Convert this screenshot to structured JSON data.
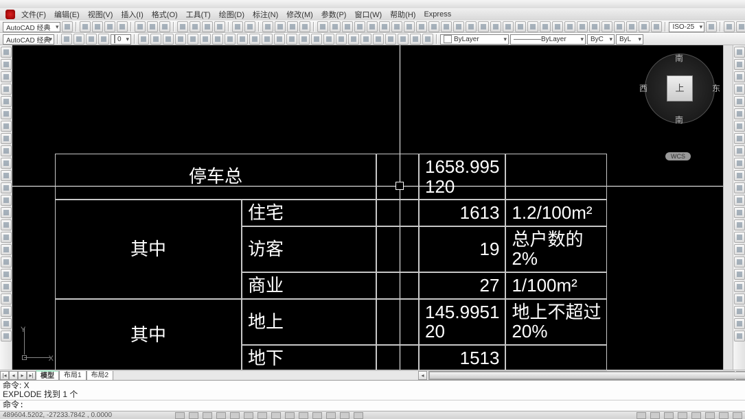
{
  "window": {
    "minimize": "—",
    "close": "✕"
  },
  "menu": [
    "文件(F)",
    "编辑(E)",
    "视图(V)",
    "插入(I)",
    "格式(O)",
    "工具(T)",
    "绘图(D)",
    "标注(N)",
    "修改(M)",
    "参数(P)",
    "窗口(W)",
    "帮助(H)",
    "Express"
  ],
  "workspace": "AutoCAD 经典",
  "dimstyle": "ISO-25",
  "layer_combo": "0",
  "linetype_combo": "ByLayer",
  "lineweight_combo": "ByLayer",
  "plotstyle_combo1": "ByC",
  "plotstyle_combo2": "ByL",
  "viewcube": {
    "top": "上",
    "n": "南",
    "s": "南",
    "e": "东",
    "w": "西",
    "wcs": "WCS"
  },
  "ucs": {
    "x": "X",
    "y": "Y"
  },
  "tabs": {
    "model": "模型",
    "layout1": "布局1",
    "layout2": "布局2"
  },
  "nav": {
    "first": "|◂",
    "prev": "◂",
    "next": "▸",
    "last": "▸|"
  },
  "scroll": {
    "left": "◂",
    "right": "▸"
  },
  "command": {
    "line1": "命令: X",
    "line2": "EXPLODE 找到 1 个",
    "prompt": "命令:"
  },
  "status": {
    "coords": "489604.5202, -27233.7842 , 0.0000"
  },
  "chart_data": {
    "type": "table",
    "title": "停车总",
    "rows": [
      {
        "label": "停车总",
        "value": "1658.995120",
        "note": ""
      },
      {
        "group": "其中",
        "label": "住宅",
        "value": "1613",
        "note": "1.2/100m²"
      },
      {
        "group": "其中",
        "label": "访客",
        "value": "19",
        "note": "总户数的2%"
      },
      {
        "group": "其中",
        "label": "商业",
        "value": "27",
        "note": "1/100m²"
      },
      {
        "group": "其中",
        "label": "地上",
        "value": "145.995120",
        "note": "地上不超过20%"
      },
      {
        "group": "其中",
        "label": "地下",
        "value": "1513",
        "note": ""
      }
    ]
  },
  "tbl": {
    "r0c0": "停车总",
    "r0c2": "1658.995",
    "r0c2b": "120",
    "g1": "其中",
    "r1c1": "住宅",
    "r1c2": "1613",
    "r1c3": "1.2/100m²",
    "r2c1": "访客",
    "r2c2": "19",
    "r2c3": "总户数的2%",
    "r3c1": "商业",
    "r3c2": "27",
    "r3c3": "1/100m²",
    "g2": "其中",
    "r4c1": "地上",
    "r4c2": "145.9951",
    "r4c2b": "20",
    "r4c3": "地上不超过",
    "r4c3b": "20%",
    "r5c1": "地下",
    "r5c2": "1513"
  }
}
